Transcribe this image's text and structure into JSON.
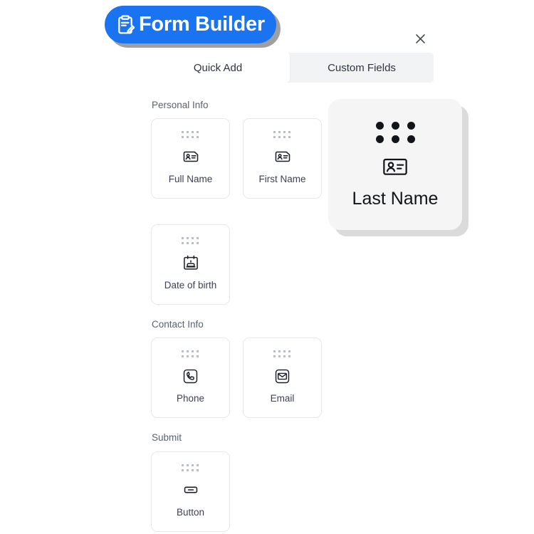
{
  "app": {
    "title": "Form Builder",
    "title_icon": "clipboard-pencil-icon",
    "accent_color": "#1a73f0",
    "close_label": "×"
  },
  "tabs": [
    {
      "label": "Quick Add",
      "active": true
    },
    {
      "label": "Custom Fields",
      "active": false
    }
  ],
  "sections": [
    {
      "title": "Personal Info",
      "cards": [
        {
          "label": "Full Name",
          "icon": "id-card-person-icon"
        },
        {
          "label": "First Name",
          "icon": "id-card-person-icon"
        },
        {
          "label": "Date of birth",
          "icon": "birthday-calendar-icon"
        }
      ]
    },
    {
      "title": "Contact Info",
      "cards": [
        {
          "label": "Phone",
          "icon": "phone-icon"
        },
        {
          "label": "Email",
          "icon": "envelope-icon"
        }
      ]
    },
    {
      "title": "Submit",
      "cards": [
        {
          "label": "Button",
          "icon": "button-icon"
        }
      ]
    }
  ],
  "drag_item": {
    "label": "Last Name",
    "icon": "id-card-person-icon",
    "background": "#f5f5f5"
  }
}
